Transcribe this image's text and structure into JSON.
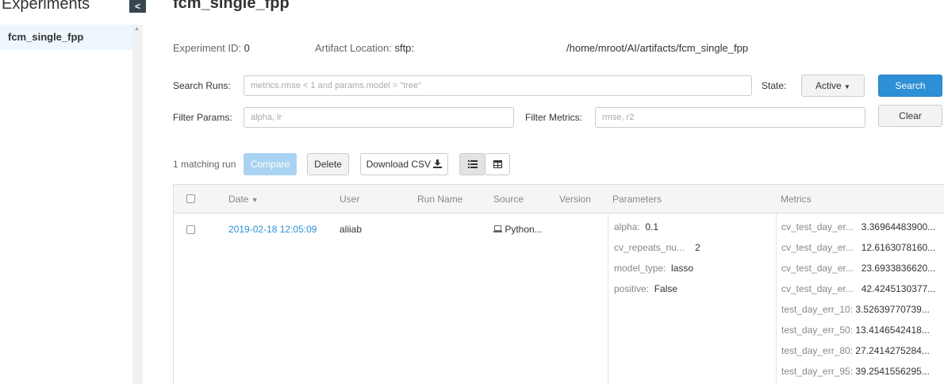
{
  "sidebar": {
    "title": "Experiments",
    "collapse_glyph": "<",
    "items": [
      {
        "label": "fcm_single_fpp"
      }
    ]
  },
  "experiment": {
    "title": "fcm_single_fpp",
    "id_label": "Experiment ID:",
    "id_value": "0",
    "artifact_label": "Artifact Location:",
    "artifact_scheme": "sftp:",
    "artifact_path": "/home/mroot/AI/artifacts/fcm_single_fpp"
  },
  "search": {
    "label": "Search Runs:",
    "placeholder": "metrics.rmse < 1 and params.model = \"tree\"",
    "state_label": "State:",
    "state_value": "Active",
    "search_button": "Search"
  },
  "filters": {
    "params_label": "Filter Params:",
    "params_placeholder": "alpha, lr",
    "metrics_label": "Filter Metrics:",
    "metrics_placeholder": "rmse, r2",
    "clear_button": "Clear"
  },
  "toolbar": {
    "matching": "1 matching run",
    "compare": "Compare",
    "delete": "Delete",
    "download": "Download CSV"
  },
  "table": {
    "headers": {
      "date": "Date",
      "user": "User",
      "run_name": "Run Name",
      "source": "Source",
      "version": "Version",
      "parameters": "Parameters",
      "metrics": "Metrics"
    },
    "rows": [
      {
        "date": "2019-02-18 12:05:09",
        "user": "aliiab",
        "run_name": "",
        "source": "Python...",
        "version": "",
        "params": [
          {
            "k": "alpha:",
            "v": "0.1"
          },
          {
            "k": "cv_repeats_nu...",
            "v": "2"
          },
          {
            "k": "model_type:",
            "v": "lasso"
          },
          {
            "k": "positive:",
            "v": "False"
          }
        ],
        "metrics": [
          {
            "k": "cv_test_day_er...",
            "v": "3.36964483900..."
          },
          {
            "k": "cv_test_day_er...",
            "v": "12.6163078160..."
          },
          {
            "k": "cv_test_day_er...",
            "v": "23.6933836620..."
          },
          {
            "k": "cv_test_day_er...",
            "v": "42.4245130377..."
          },
          {
            "k": "test_day_err_10:",
            "v": "3.52639770739..."
          },
          {
            "k": "test_day_err_50:",
            "v": "13.4146542418..."
          },
          {
            "k": "test_day_err_80:",
            "v": "27.2414275284..."
          },
          {
            "k": "test_day_err_95:",
            "v": "39.2541556295..."
          }
        ]
      }
    ]
  },
  "colors": {
    "link": "#2d8fd5",
    "primary": "#2d8fd5",
    "sidebar_active": "#eef7fd"
  }
}
